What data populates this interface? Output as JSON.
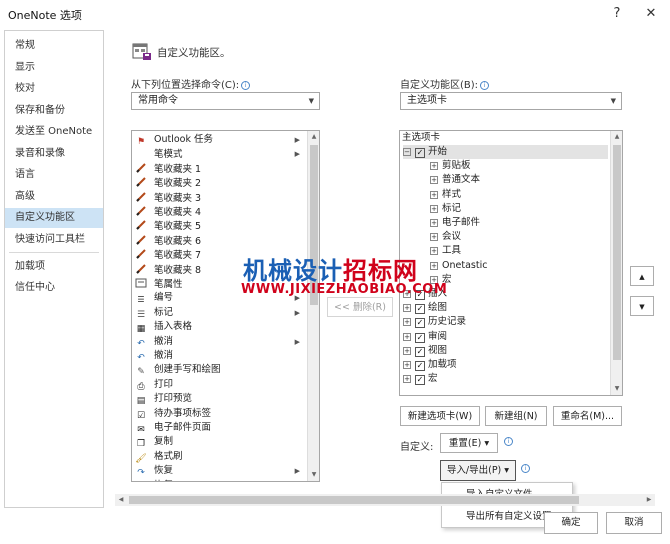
{
  "window": {
    "title": "OneNote 选项",
    "help": "?",
    "close": "✕"
  },
  "sidebar": {
    "items": [
      {
        "label": "常规"
      },
      {
        "label": "显示"
      },
      {
        "label": "校对"
      },
      {
        "label": "保存和备份"
      },
      {
        "label": "发送至 OneNote"
      },
      {
        "label": "录音和录像"
      },
      {
        "label": "语言"
      },
      {
        "label": "高级"
      },
      {
        "label": "自定义功能区",
        "selected": true
      },
      {
        "label": "快速访问工具栏"
      },
      {
        "label": "加载项"
      },
      {
        "label": "信任中心"
      }
    ]
  },
  "header": {
    "title": "自定义功能区。",
    "icon": "customize-ribbon-icon"
  },
  "left_panel": {
    "label": "从下列位置选择命令(C):",
    "info": "i",
    "combo_value": "常用命令",
    "commands": [
      {
        "label": "Outlook 任务",
        "icon": "flag-icon",
        "submenu": true
      },
      {
        "label": "笔模式",
        "icon": "",
        "submenu": true
      },
      {
        "label": "笔收藏夹 1",
        "icon": "pen-icon"
      },
      {
        "label": "笔收藏夹 2",
        "icon": "pen-icon"
      },
      {
        "label": "笔收藏夹 3",
        "icon": "pen-icon"
      },
      {
        "label": "笔收藏夹 4",
        "icon": "pen-icon"
      },
      {
        "label": "笔收藏夹 5",
        "icon": "pen-icon"
      },
      {
        "label": "笔收藏夹 6",
        "icon": "pen-icon"
      },
      {
        "label": "笔收藏夹 7",
        "icon": "pen-icon"
      },
      {
        "label": "笔收藏夹 8",
        "icon": "pen-icon"
      },
      {
        "label": "笔属性",
        "icon": "pen-properties-icon"
      },
      {
        "label": "编号",
        "icon": "numbering-icon",
        "submenu": true
      },
      {
        "label": "标记",
        "icon": "tag-icon",
        "submenu": true
      },
      {
        "label": "插入表格",
        "icon": "table-icon"
      },
      {
        "label": "撤消",
        "icon": "undo-icon",
        "submenu": true
      },
      {
        "label": "撤消",
        "icon": "undo-icon"
      },
      {
        "label": "创建手写和绘图",
        "icon": "draw-icon"
      },
      {
        "label": "打印",
        "icon": "print-icon"
      },
      {
        "label": "打印预览",
        "icon": "print-preview-icon"
      },
      {
        "label": "待办事项标签",
        "icon": "checkbox-icon"
      },
      {
        "label": "电子邮件页面",
        "icon": "email-icon"
      },
      {
        "label": "复制",
        "icon": "copy-icon"
      },
      {
        "label": "格式刷",
        "icon": "format-painter-icon"
      },
      {
        "label": "恢复",
        "icon": "redo-icon",
        "submenu": true
      },
      {
        "label": "恢复",
        "icon": "redo-icon"
      }
    ]
  },
  "middle": {
    "remove_button": "<< 删除(R)"
  },
  "right_panel": {
    "label": "自定义功能区(B):",
    "info": "i",
    "combo_value": "主选项卡",
    "tree_header": "主选项卡",
    "tree": [
      {
        "label": "开始",
        "level": 0,
        "expander": "⊟",
        "checkbox": true,
        "highlight": true
      },
      {
        "label": "剪贴板",
        "level": 1,
        "expander": "⊞"
      },
      {
        "label": "普通文本",
        "level": 1,
        "expander": "⊞"
      },
      {
        "label": "样式",
        "level": 1,
        "expander": "⊞"
      },
      {
        "label": "标记",
        "level": 1,
        "expander": "⊞"
      },
      {
        "label": "电子邮件",
        "level": 1,
        "expander": "⊞"
      },
      {
        "label": "会议",
        "level": 1,
        "expander": "⊞"
      },
      {
        "label": "工具",
        "level": 1,
        "expander": "⊞"
      },
      {
        "label": "Onetastic",
        "level": 1,
        "expander": "⊞"
      },
      {
        "label": "宏",
        "level": 1,
        "expander": "⊞"
      },
      {
        "label": "插入",
        "level": 0,
        "expander": "⊞",
        "checkbox": true
      },
      {
        "label": "绘图",
        "level": 0,
        "expander": "⊞",
        "checkbox": true
      },
      {
        "label": "历史记录",
        "level": 0,
        "expander": "⊞",
        "checkbox": true
      },
      {
        "label": "审阅",
        "level": 0,
        "expander": "⊞",
        "checkbox": true
      },
      {
        "label": "视图",
        "level": 0,
        "expander": "⊞",
        "checkbox": true
      },
      {
        "label": "加载项",
        "level": 0,
        "expander": "⊞",
        "checkbox": true
      },
      {
        "label": "宏",
        "level": 0,
        "expander": "⊞",
        "checkbox": true
      }
    ],
    "new_tab_button": "新建选项卡(W)",
    "new_group_button": "新建组(N)",
    "rename_button": "重命名(M)...",
    "customize_label": "自定义:",
    "reset_button": "重置(E) ▾",
    "import_export_button": "导入/导出(P) ▾",
    "move_up": "▲",
    "move_down": "▼"
  },
  "dropdown_menu": {
    "items": [
      {
        "label": "导入自定义文件"
      },
      {
        "label": "导出所有自定义设置"
      }
    ]
  },
  "footer": {
    "ok_button": "确定",
    "cancel_button": "取消"
  },
  "watermark": {
    "line1_blue": "机械设计",
    "line1_red": "招标网",
    "line2": "WWW.JIXIEZHAOBIAO.COM"
  }
}
